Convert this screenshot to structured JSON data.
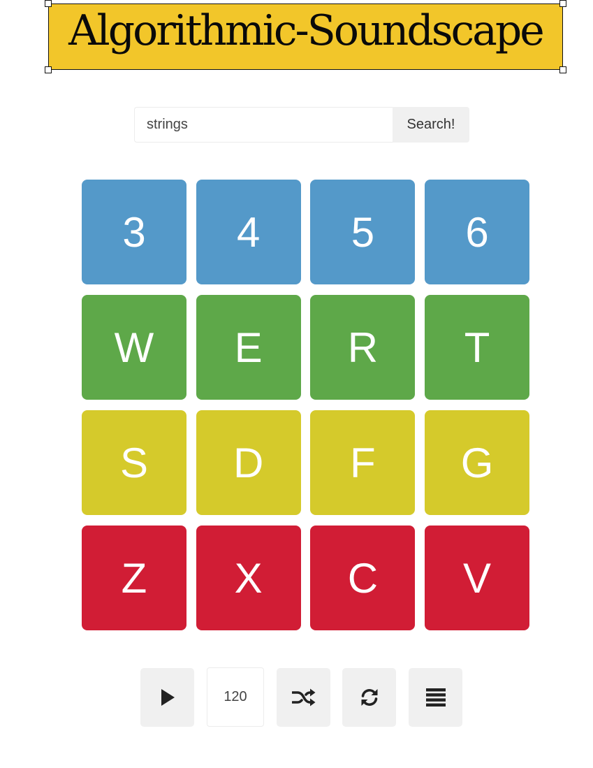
{
  "header": {
    "title": "Algorithmic-Soundscape"
  },
  "search": {
    "value": "strings",
    "button_label": "Search!"
  },
  "pads": [
    {
      "label": "3",
      "color": "#5499c9"
    },
    {
      "label": "4",
      "color": "#5499c9"
    },
    {
      "label": "5",
      "color": "#5499c9"
    },
    {
      "label": "6",
      "color": "#5499c9"
    },
    {
      "label": "W",
      "color": "#5ea849"
    },
    {
      "label": "E",
      "color": "#5ea849"
    },
    {
      "label": "R",
      "color": "#5ea849"
    },
    {
      "label": "T",
      "color": "#5ea849"
    },
    {
      "label": "S",
      "color": "#d5ca2b"
    },
    {
      "label": "D",
      "color": "#d5ca2b"
    },
    {
      "label": "F",
      "color": "#d5ca2b"
    },
    {
      "label": "G",
      "color": "#d5ca2b"
    },
    {
      "label": "Z",
      "color": "#d11d35"
    },
    {
      "label": "X",
      "color": "#d11d35"
    },
    {
      "label": "C",
      "color": "#d11d35"
    },
    {
      "label": "V",
      "color": "#d11d35"
    }
  ],
  "controls": {
    "play_icon": "play-icon",
    "bpm_value": "120",
    "shuffle_icon": "shuffle-icon",
    "refresh_icon": "refresh-icon",
    "menu_icon": "menu-icon"
  },
  "colors": {
    "title_background": "#f2c62a",
    "row1": "#5499c9",
    "row2": "#5ea849",
    "row3": "#d5ca2b",
    "row4": "#d11d35",
    "control_background": "#f0f0f0"
  }
}
